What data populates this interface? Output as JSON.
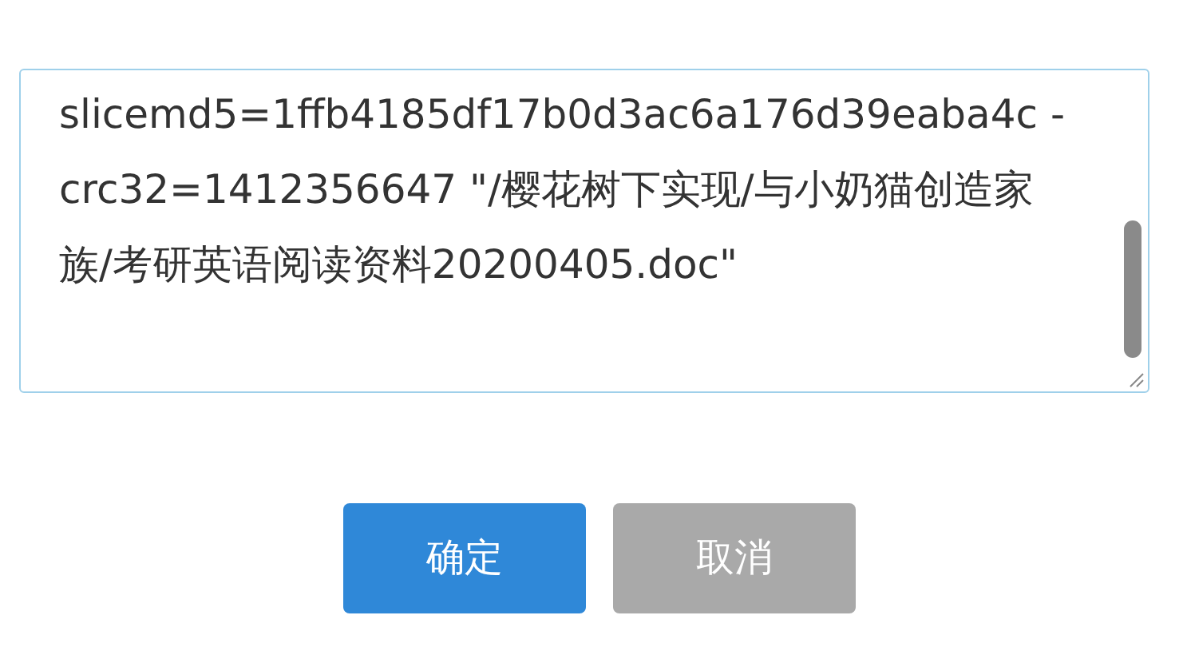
{
  "textarea": {
    "value": "slicemd5=1ffb4185df17b0d3ac6a176d39eaba4c -crc32=1412356647 \"/樱花树下实现/与小奶猫创造家族/考研英语阅读资料20200405.doc\"",
    "focused": true
  },
  "buttons": [
    {
      "label": "确定",
      "kind": "primary"
    },
    {
      "label": "取消",
      "kind": "secondary"
    }
  ]
}
